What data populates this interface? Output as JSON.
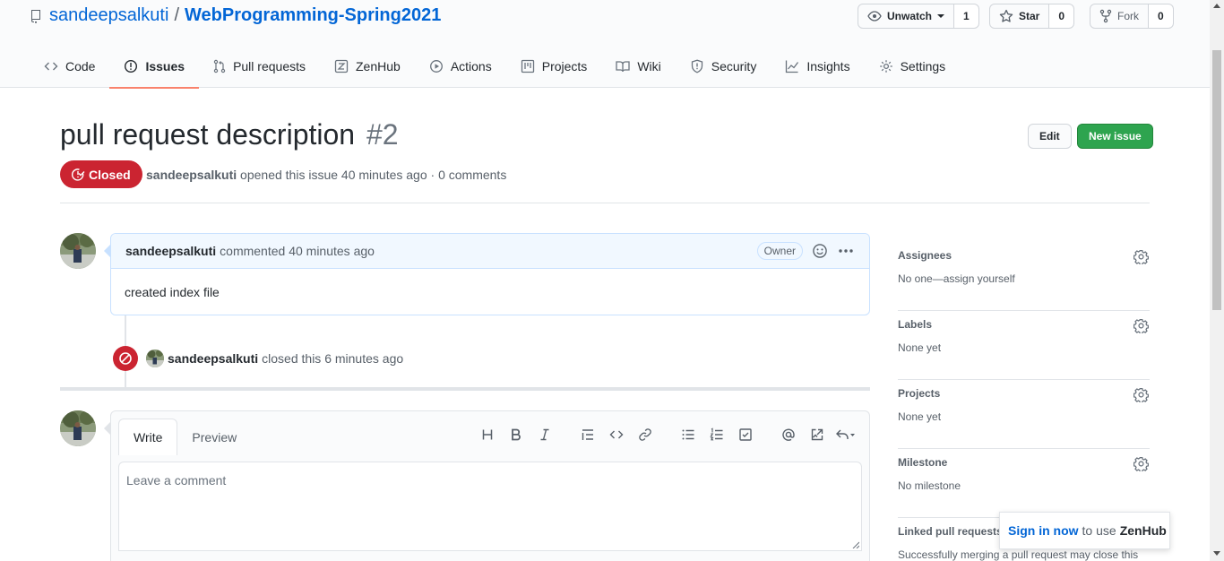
{
  "repo": {
    "owner": "sandeepsalkuti",
    "separator": "/",
    "name": "WebProgramming-Spring2021",
    "watch_label": "Unwatch",
    "watch_count": "1",
    "star_label": "Star",
    "star_count": "0",
    "fork_label": "Fork",
    "fork_count": "0"
  },
  "nav": {
    "code": "Code",
    "issues": "Issues",
    "pulls": "Pull requests",
    "zenhub": "ZenHub",
    "actions": "Actions",
    "projects": "Projects",
    "wiki": "Wiki",
    "security": "Security",
    "insights": "Insights",
    "settings": "Settings"
  },
  "issue": {
    "title": "pull request description",
    "number": "#2",
    "state": "Closed",
    "author": "sandeepsalkuti",
    "meta": "opened this issue 40 minutes ago · 0 comments",
    "edit_label": "Edit",
    "new_label": "New issue"
  },
  "comment": {
    "author": "sandeepsalkuti",
    "time": "commented 40 minutes ago",
    "role": "Owner",
    "body": "created index file"
  },
  "event": {
    "author": "sandeepsalkuti",
    "text": "closed this 6 minutes ago"
  },
  "form": {
    "write_tab": "Write",
    "preview_tab": "Preview",
    "placeholder": "Leave a comment"
  },
  "sidebar": {
    "assignees": {
      "heading": "Assignees",
      "value": "No one—assign yourself"
    },
    "labels": {
      "heading": "Labels",
      "value": "None yet"
    },
    "projects": {
      "heading": "Projects",
      "value": "None yet"
    },
    "milestone": {
      "heading": "Milestone",
      "value": "No milestone"
    },
    "linked": {
      "heading": "Linked pull requests",
      "value": "Successfully merging a pull request may close this"
    }
  },
  "zenhub_popup": {
    "signin": "Sign in now",
    "text": "to use",
    "brand": "ZenHub"
  },
  "colors": {
    "link": "#0366d6",
    "closed": "#cb2431",
    "primary_button": "#2ea44f",
    "nav_underline": "#f9826c"
  }
}
